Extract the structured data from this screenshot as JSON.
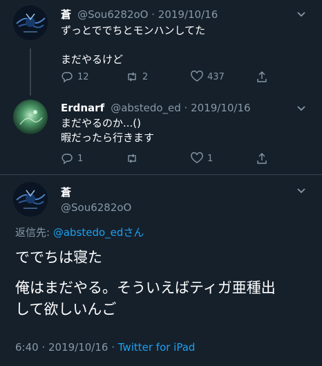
{
  "tweets": [
    {
      "name": "蒼",
      "handle": "@Sou6282oO · 2019/10/16",
      "text": "ずっとででちとモンハンしてた\n\nまだやるけど",
      "replies": "12",
      "retweets": "2",
      "likes": "437"
    },
    {
      "name": "Erdnarf",
      "handle": "@abstedo_ed · 2019/10/16",
      "text": "まだやるのか...()\n暇だったら行きます",
      "replies": "1",
      "retweets": "",
      "likes": "1"
    }
  ],
  "main_tweet": {
    "name": "蒼",
    "handle": "@Sou6282oO",
    "reply_prefix": "返信先: ",
    "reply_to": "@abstedo_edさん",
    "line1": "ででちは寝た",
    "line2": "俺はまだやる。そういえばティガ亜種出\nして欲しいんご",
    "timestamp": "6:40 · 2019/10/16 · ",
    "client": "Twitter for iPad"
  },
  "colors": {
    "background": "#15202b",
    "secondary_text": "#8899a6",
    "accent": "#1da1f2",
    "divider": "#38444d"
  }
}
